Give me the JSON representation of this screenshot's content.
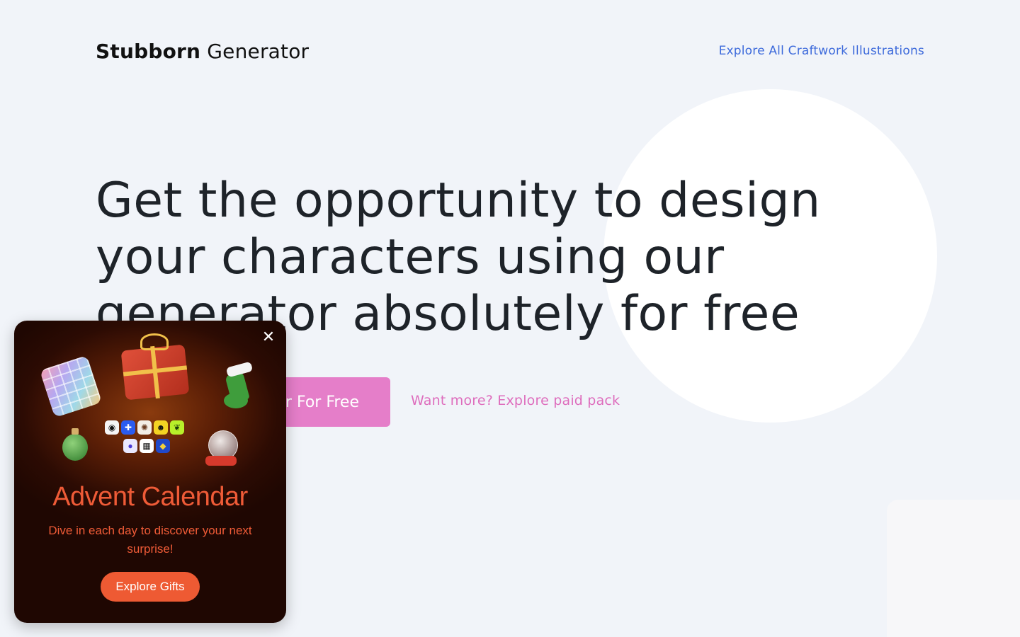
{
  "header": {
    "logo_bold": "Stubborn",
    "logo_light": " Generator",
    "nav_link": "Explore All Craftwork Illustrations"
  },
  "hero": {
    "headline": "Get the opportunity to design your characters using our generator absolutely for free",
    "cta_button": "r For Free",
    "paid_link": "Want more? Explore paid pack"
  },
  "popup": {
    "close_icon": "close-icon",
    "title": "Advent Calendar",
    "text": "Dive in each day to discover your next surprise!",
    "button": "Explore Gifts"
  },
  "colors": {
    "background": "#f1f4f9",
    "link_blue": "#3d6adb",
    "cta_pink": "#e57ec9",
    "popup_orange": "#ee5a33"
  }
}
